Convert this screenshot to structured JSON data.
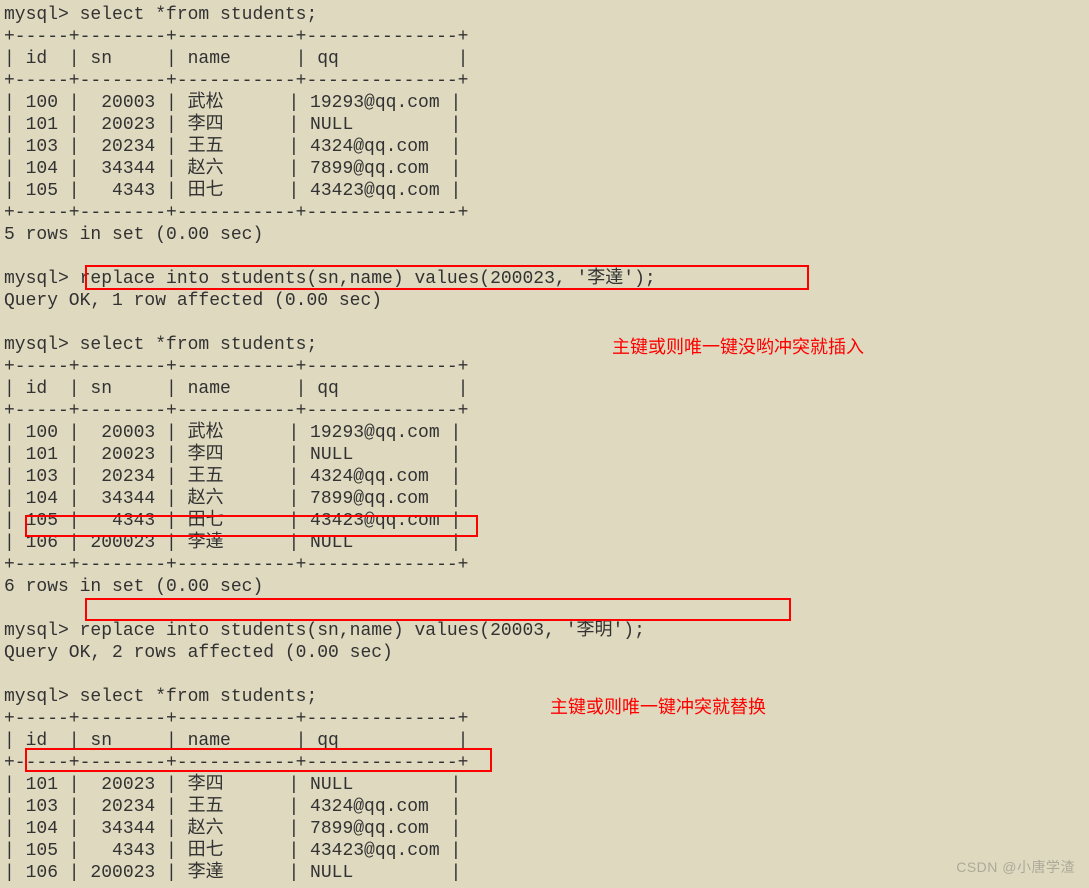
{
  "prompt": "mysql>",
  "queries": {
    "select": "select *from students;",
    "replace1": "replace into students(sn,name) values(200023, '李達');",
    "replace2": "replace into students(sn,name) values(20003, '李明');"
  },
  "results": {
    "ok1row": "Query OK, 1 row affected (0.00 sec)",
    "ok2rows": "Query OK, 2 rows affected (0.00 sec)",
    "rows5": "5 rows in set (0.00 sec)",
    "rows6": "6 rows in set (0.00 sec)"
  },
  "headers": {
    "id": "id",
    "sn": "sn",
    "name": "name",
    "qq": "qq"
  },
  "tables": {
    "t1": [
      {
        "id": "100",
        "sn": "20003",
        "name": "武松",
        "qq": "19293@qq.com"
      },
      {
        "id": "101",
        "sn": "20023",
        "name": "李四",
        "qq": "NULL"
      },
      {
        "id": "103",
        "sn": "20234",
        "name": "王五",
        "qq": "4324@qq.com"
      },
      {
        "id": "104",
        "sn": "34344",
        "name": "赵六",
        "qq": "7899@qq.com"
      },
      {
        "id": "105",
        "sn": "4343",
        "name": "田七",
        "qq": "43423@qq.com"
      }
    ],
    "t2": [
      {
        "id": "100",
        "sn": "20003",
        "name": "武松",
        "qq": "19293@qq.com"
      },
      {
        "id": "101",
        "sn": "20023",
        "name": "李四",
        "qq": "NULL"
      },
      {
        "id": "103",
        "sn": "20234",
        "name": "王五",
        "qq": "4324@qq.com"
      },
      {
        "id": "104",
        "sn": "34344",
        "name": "赵六",
        "qq": "7899@qq.com"
      },
      {
        "id": "105",
        "sn": "4343",
        "name": "田七",
        "qq": "43423@qq.com"
      },
      {
        "id": "106",
        "sn": "200023",
        "name": "李達",
        "qq": "NULL"
      }
    ],
    "t3": [
      {
        "id": "101",
        "sn": "20023",
        "name": "李四",
        "qq": "NULL"
      },
      {
        "id": "103",
        "sn": "20234",
        "name": "王五",
        "qq": "4324@qq.com"
      },
      {
        "id": "104",
        "sn": "34344",
        "name": "赵六",
        "qq": "7899@qq.com"
      },
      {
        "id": "105",
        "sn": "4343",
        "name": "田七",
        "qq": "43423@qq.com"
      },
      {
        "id": "106",
        "sn": "200023",
        "name": "李達",
        "qq": "NULL"
      }
    ]
  },
  "annotations": {
    "a1": "主键或则唯一键没哟冲突就插入",
    "a2": "主键或则唯一键冲突就替换"
  },
  "watermark": "CSDN @小唐学渣"
}
